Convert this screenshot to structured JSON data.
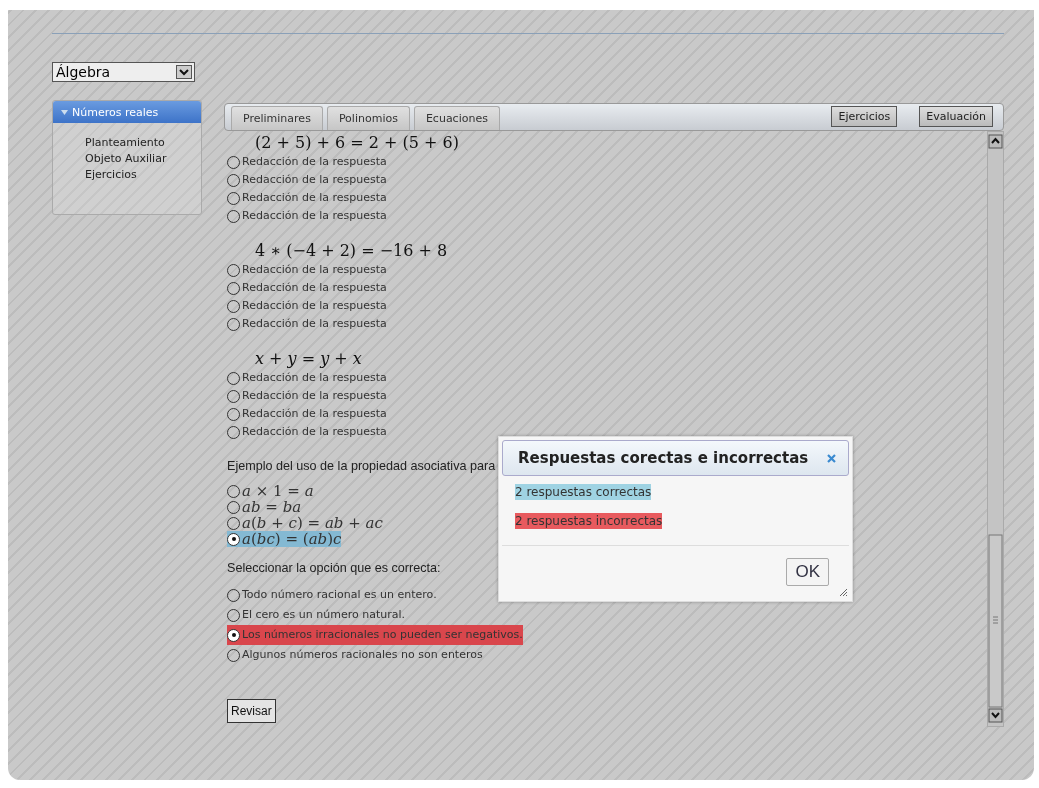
{
  "subject_select": {
    "value": "Álgebra"
  },
  "sidebar": {
    "header": "Números reales",
    "expanded": true,
    "items": [
      "Planteamiento",
      "Objeto Auxiliar",
      "Ejercicios"
    ]
  },
  "tabs": [
    {
      "label": "Preliminares",
      "selected": false
    },
    {
      "label": "Polinomios",
      "selected": false
    },
    {
      "label": "Ecuaciones",
      "selected": false
    }
  ],
  "tool_buttons": [
    "Ejercicios",
    "Evaluación"
  ],
  "questions": [
    {
      "kind": "formula",
      "prompt": "(2 + 5) + 6 = 2 + (5 + 6)",
      "options": [
        {
          "label": "Redacción de la respuesta",
          "selected": false
        },
        {
          "label": "Redacción de la respuesta",
          "selected": false
        },
        {
          "label": "Redacción de la respuesta",
          "selected": false
        },
        {
          "label": "Redacción de la respuesta",
          "selected": false
        }
      ]
    },
    {
      "kind": "formula",
      "prompt": "4 ∗ (−4 + 2) = −16 + 8",
      "options": [
        {
          "label": "Redacción de la respuesta",
          "selected": false
        },
        {
          "label": "Redacción de la respuesta",
          "selected": false
        },
        {
          "label": "Redacción de la respuesta",
          "selected": false
        },
        {
          "label": "Redacción de la respuesta",
          "selected": false
        }
      ]
    },
    {
      "kind": "formula",
      "prompt": "*x* + *y* = *y* + *x*",
      "options": [
        {
          "label": "Redacción de la respuesta",
          "selected": false
        },
        {
          "label": "Redacción de la respuesta",
          "selected": false
        },
        {
          "label": "Redacción de la respuesta",
          "selected": false
        },
        {
          "label": "Redacción de la respuesta",
          "selected": false
        }
      ]
    },
    {
      "kind": "math_choice",
      "prompt": "Ejemplo del uso de la propiedad asociativa para",
      "options": [
        {
          "label": "*a* × 1 = *a*",
          "selected": false
        },
        {
          "label": "*ab* = *ba*",
          "selected": false
        },
        {
          "label": "*a*(*b* + *c*) = *ab* + *ac*",
          "selected": false
        },
        {
          "label": "*a*(*bc*) = (*ab*)*c*",
          "selected": true,
          "color": "#84b9d3"
        }
      ]
    },
    {
      "kind": "text_choice",
      "prompt": "Seleccionar la opción que es correcta:",
      "options": [
        {
          "label": "Todo número racional es un entero.",
          "selected": false
        },
        {
          "label": "El cero es un número natural.",
          "selected": false
        },
        {
          "label": "Los números irracionales no pueden ser negativos.",
          "selected": true,
          "color": "#d9464c"
        },
        {
          "label": "Algunos números racionales no son enteros",
          "selected": false
        }
      ]
    }
  ],
  "check_button": "Revisar",
  "dialog": {
    "title": "Respuestas corectas e incorrectas",
    "lines": [
      {
        "text": "2 respuestas correctas",
        "color": "#9fd3e3"
      },
      {
        "text": "2 respuestas incorrectas",
        "color": "#e85a5e"
      }
    ],
    "ok_button": "OK"
  }
}
